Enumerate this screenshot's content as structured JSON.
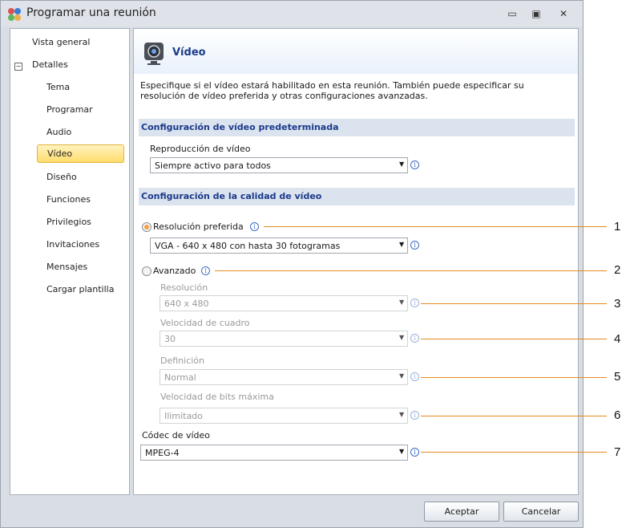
{
  "window": {
    "title": "Programar una reunión"
  },
  "sidebar": {
    "items": [
      {
        "label": "Vista general"
      },
      {
        "label": "Detalles"
      },
      {
        "label": "Tema"
      },
      {
        "label": "Programar"
      },
      {
        "label": "Audio"
      },
      {
        "label": "Vídeo"
      },
      {
        "label": "Diseño"
      },
      {
        "label": "Funciones"
      },
      {
        "label": "Privilegios"
      },
      {
        "label": "Invitaciones"
      },
      {
        "label": "Mensajes"
      },
      {
        "label": "Cargar plantilla"
      }
    ],
    "expander_symbol": "−",
    "selected": "Vídeo"
  },
  "panel": {
    "title": "Vídeo",
    "description": "Especifique si el vídeo estará habilitado en esta reunión.  También puede especificar su resolución de vídeo preferida y otras configuraciones avanzadas.",
    "section_default": "Configuración de vídeo predeterminada",
    "playback_label": "Reproducción de vídeo",
    "playback_value": "Siempre activo para todos",
    "section_quality": "Configuración de la calidad de vídeo",
    "preferred_label": "Resolución preferida",
    "preferred_value": "VGA - 640 x 480 con hasta 30 fotogramas",
    "advanced_label": "Avanzado",
    "resolution_label": "Resolución",
    "resolution_value": "640 x 480",
    "framerate_label": "Velocidad de cuadro",
    "framerate_value": "30",
    "definition_label": "Definición",
    "definition_value": "Normal",
    "bitrate_label": "Velocidad de bits máxima",
    "bitrate_value": "Ilimitado",
    "codec_label": "Códec de vídeo",
    "codec_value": "MPEG-4"
  },
  "buttons": {
    "accept": "Aceptar",
    "cancel": "Cancelar"
  },
  "callouts": [
    "1",
    "2",
    "3",
    "4",
    "5",
    "6",
    "7"
  ],
  "icons": {
    "info": "i",
    "dropdown": "▼",
    "minimize": "▭",
    "maximize": "▣",
    "close": "✕"
  },
  "colors": {
    "accent": "#e48a1f",
    "section_bg": "#dbe3ef",
    "title_blue": "#1b3a8a",
    "selection": "#ffdc6c"
  }
}
